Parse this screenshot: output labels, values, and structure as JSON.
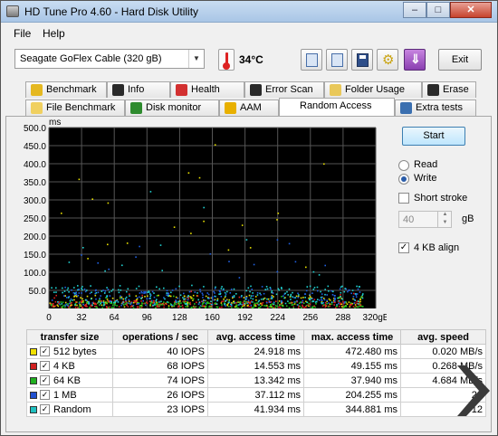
{
  "window": {
    "title": "HD Tune Pro 4.60 - Hard Disk Utility",
    "min": "–",
    "max": "□",
    "close": "✕"
  },
  "menu": {
    "file": "File",
    "help": "Help"
  },
  "toolbar": {
    "drive": "Seagate GoFlex Cable    (320 gB)",
    "temperature": "34°C",
    "exit": "Exit",
    "download_glyph": "⇓"
  },
  "tabs": {
    "row1": [
      "Benchmark",
      "Info",
      "Health",
      "Error Scan",
      "Folder Usage",
      "Erase"
    ],
    "row2": [
      "File Benchmark",
      "Disk monitor",
      "AAM",
      "Random Access",
      "Extra tests"
    ],
    "active": "Random Access"
  },
  "colors": {
    "plot_bg": "#000000",
    "grid": "#555555",
    "tab_icons": [
      "#e5b820",
      "#2a2a2a",
      "#d23030",
      "#2a2a2a",
      "#e9c85a",
      "#2a2a2a"
    ],
    "tab2_icons": [
      "#f0d060",
      "#2e8b2e",
      "#e8b000",
      "#ffffff",
      "#3a6fb0"
    ]
  },
  "chart_data": {
    "type": "scatter",
    "ylabel": "ms",
    "xlabel": "",
    "x_ticks": [
      "0",
      "32",
      "64",
      "96",
      "128",
      "160",
      "192",
      "224",
      "256",
      "288",
      "320gB"
    ],
    "y_ticks": [
      "500.0",
      "450.0",
      "400.0",
      "350.0",
      "300.0",
      "250.0",
      "200.0",
      "150.0",
      "100.0",
      "50.0"
    ],
    "xlim": [
      0,
      320
    ],
    "ylim": [
      0,
      500
    ],
    "grid": true,
    "series": [
      {
        "name": "512 bytes",
        "color": "#e8e000",
        "typical": 25,
        "max": 472
      },
      {
        "name": "4 KB",
        "color": "#e02020",
        "typical": 15,
        "max": 49
      },
      {
        "name": "64 KB",
        "color": "#20c020",
        "typical": 13,
        "max": 38
      },
      {
        "name": "1 MB",
        "color": "#2060e0",
        "typical": 37,
        "max": 204
      },
      {
        "name": "Random",
        "color": "#20d0d0",
        "typical": 42,
        "max": 345
      }
    ]
  },
  "controls": {
    "start": "Start",
    "read": "Read",
    "write": "Write",
    "short_stroke": "Short stroke",
    "stroke_value": "40",
    "stroke_unit": "gB",
    "align": "4 KB align",
    "mode": "Write",
    "align_checked": true,
    "short_stroke_checked": false
  },
  "table": {
    "headers": [
      "transfer size",
      "operations / sec",
      "avg. access time",
      "max. access time",
      "avg. speed"
    ],
    "rows": [
      {
        "size": "512 bytes",
        "color": "#f0e000",
        "ops": "40 IOPS",
        "avg": "24.918 ms",
        "max": "472.480 ms",
        "speed": "0.020 MB/s"
      },
      {
        "size": "4 KB",
        "color": "#d02020",
        "ops": "68 IOPS",
        "avg": "14.553 ms",
        "max": "49.155 ms",
        "speed": "0.268 MB/s"
      },
      {
        "size": "64 KB",
        "color": "#20b020",
        "ops": "74 IOPS",
        "avg": "13.342 ms",
        "max": "37.940 ms",
        "speed": "4.684 MB/s"
      },
      {
        "size": "1 MB",
        "color": "#2050d0",
        "ops": "26 IOPS",
        "avg": "37.112 ms",
        "max": "204.255 ms",
        "speed": "26"
      },
      {
        "size": "Random",
        "color": "#20c0c0",
        "ops": "23 IOPS",
        "avg": "41.934 ms",
        "max": "344.881 ms",
        "speed": "12"
      }
    ],
    "check": "✓"
  }
}
